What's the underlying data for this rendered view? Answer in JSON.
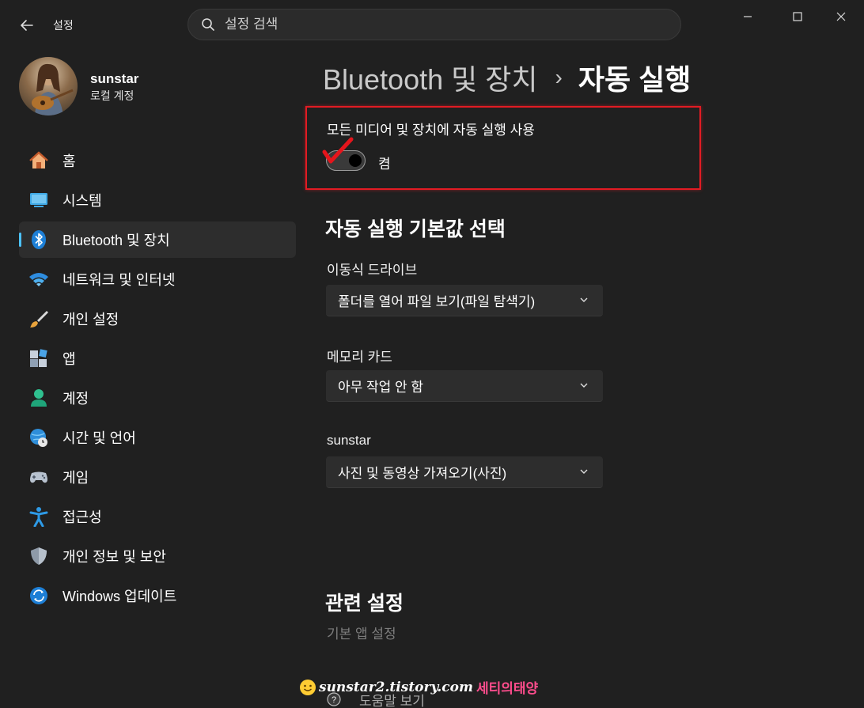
{
  "window": {
    "app_title": "설정",
    "search_placeholder": "설정 검색"
  },
  "profile": {
    "name": "sunstar",
    "account_type": "로컬 계정"
  },
  "sidebar": {
    "items": [
      {
        "label": "홈",
        "icon": "home-icon"
      },
      {
        "label": "시스템",
        "icon": "system-icon"
      },
      {
        "label": "Bluetooth 및 장치",
        "icon": "bluetooth-icon",
        "active": true
      },
      {
        "label": "네트워크 및 인터넷",
        "icon": "wifi-icon"
      },
      {
        "label": "개인 설정",
        "icon": "brush-icon"
      },
      {
        "label": "앱",
        "icon": "apps-icon"
      },
      {
        "label": "계정",
        "icon": "account-icon"
      },
      {
        "label": "시간 및 언어",
        "icon": "globe-clock-icon"
      },
      {
        "label": "게임",
        "icon": "gamepad-icon"
      },
      {
        "label": "접근성",
        "icon": "accessibility-icon"
      },
      {
        "label": "개인 정보 및 보안",
        "icon": "shield-icon"
      },
      {
        "label": "Windows 업데이트",
        "icon": "update-icon"
      }
    ]
  },
  "breadcrumb": {
    "parent": "Bluetooth 및 장치",
    "separator": "›",
    "current": "자동 실행"
  },
  "autoplay_toggle": {
    "label": "모든 미디어 및 장치에 자동 실행 사용",
    "state_text": "켬",
    "on": true
  },
  "defaults_section": {
    "title": "자동 실행 기본값 선택",
    "fields": [
      {
        "label": "이동식 드라이브",
        "value": "폴더를 열어 파일 보기(파일 탐색기)"
      },
      {
        "label": "메모리 카드",
        "value": "아무 작업 안 함"
      },
      {
        "label": "sunstar",
        "value": "사진 및 동영상 가져오기(사진)"
      }
    ]
  },
  "related_section": {
    "title": "관련 설정",
    "link": "기본 앱 설정"
  },
  "footer": {
    "help_link": "도움말 보기",
    "watermark_site": "sunstar2.tistory.com",
    "watermark_name": "세티의태양"
  },
  "colors": {
    "accent": "#4cc2ff",
    "highlight_border": "#e21b23",
    "background": "#202020"
  }
}
